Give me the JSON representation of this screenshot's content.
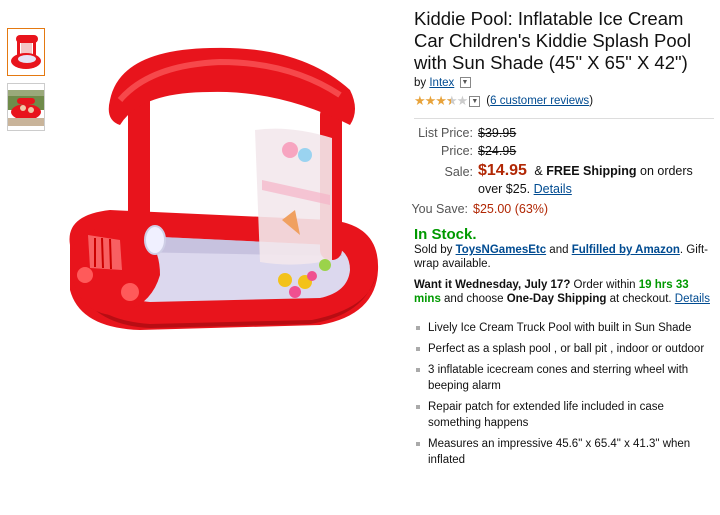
{
  "product": {
    "title": "Kiddie Pool: Inflatable Ice Cream Car Children's Kiddie Splash Pool with Sun Shade (45\" X 65\" X 42\")",
    "by_label": "by",
    "brand": "Intex",
    "rating_stars": 3.5,
    "reviews_open": "(",
    "reviews_link": "6 customer reviews",
    "reviews_close": ")"
  },
  "pricing": {
    "list_label": "List Price:",
    "list_price": "$39.95",
    "price_label": "Price:",
    "price": "$24.95",
    "sale_label": "Sale:",
    "sale_price": "$14.95",
    "shipping_prefix": "& ",
    "shipping_bold": "FREE Shipping",
    "shipping_suffix": " on orders over $25.",
    "details_link": "Details",
    "save_label": "You Save:",
    "save_value": "$25.00 (63%)"
  },
  "availability": {
    "stock": "In Stock.",
    "sold_by_prefix": "Sold by ",
    "seller": "ToysNGamesEtc",
    "and_text": " and ",
    "fulfilled": "Fulfilled by Amazon",
    "gift": ". Gift-wrap available."
  },
  "delivery": {
    "want_it": "Want it Wednesday, July 17?",
    "order_within": "  Order within ",
    "countdown": "19 hrs 33 mins",
    "choose": " and choose ",
    "shipping_option": "One-Day Shipping",
    "at_checkout": " at checkout.",
    "details_link": "Details"
  },
  "features": [
    "Lively Ice Cream Truck Pool with built in Sun Shade",
    "Perfect as a splash pool , or ball pit , indoor or outdoor",
    "3 inflatable icecream cones and sterring wheel with beeping alarm",
    "Repair patch for extended life included in case something happens",
    "Measures an impressive 45.6\" x 65.4\" x 41.3\" when inflated"
  ],
  "colors": {
    "price_red": "#b12704",
    "stock_green": "#009900",
    "link_blue": "#004b91",
    "pool_red": "#e8141c"
  }
}
